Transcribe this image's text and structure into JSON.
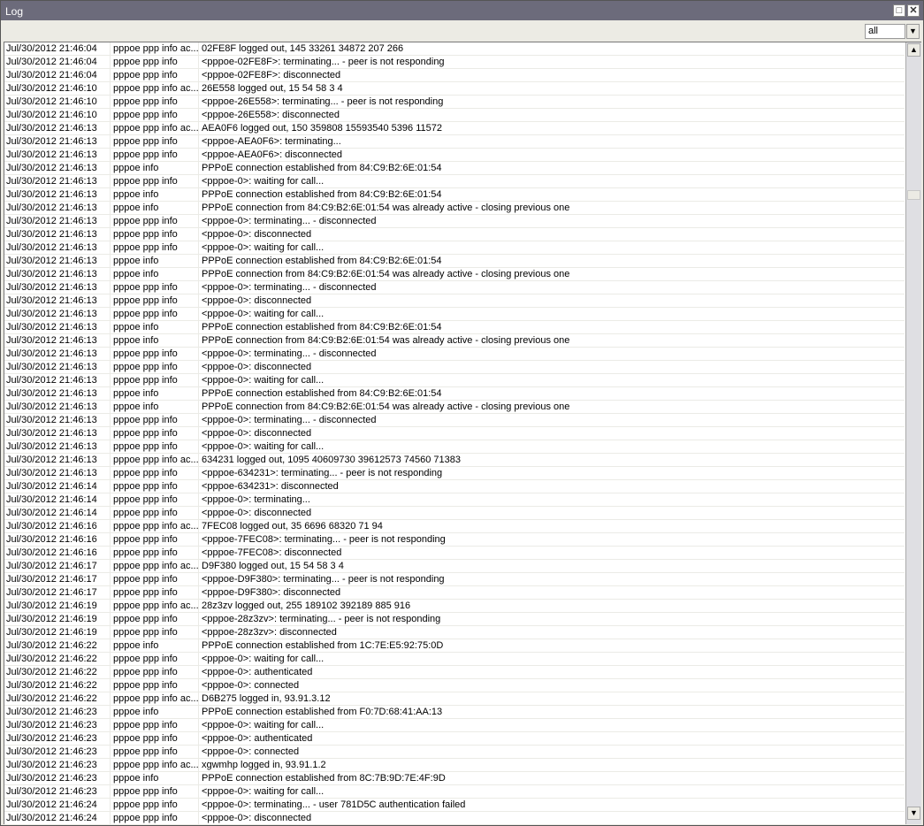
{
  "window": {
    "title": "Log",
    "maximize_icon": "maximize-icon",
    "close_icon": "close-icon"
  },
  "toolbar": {
    "filter_value": "all",
    "scroll_to_end_icon": "scroll-to-end-icon"
  },
  "scrollbar": {
    "position_fraction": 0.18
  },
  "rows": [
    [
      "Jul/30/2012 21:46:04",
      "pppoe ppp info ac...",
      "02FE8F logged out, 145 33261 34872 207 266"
    ],
    [
      "Jul/30/2012 21:46:04",
      "pppoe ppp info",
      "<pppoe-02FE8F>: terminating... - peer is not responding"
    ],
    [
      "Jul/30/2012 21:46:04",
      "pppoe ppp info",
      "<pppoe-02FE8F>: disconnected"
    ],
    [
      "Jul/30/2012 21:46:10",
      "pppoe ppp info ac...",
      "26E558 logged out, 15 54 58 3 4"
    ],
    [
      "Jul/30/2012 21:46:10",
      "pppoe ppp info",
      "<pppoe-26E558>: terminating... - peer is not responding"
    ],
    [
      "Jul/30/2012 21:46:10",
      "pppoe ppp info",
      "<pppoe-26E558>: disconnected"
    ],
    [
      "Jul/30/2012 21:46:13",
      "pppoe ppp info ac...",
      "AEA0F6 logged out, 150 359808 15593540 5396 11572"
    ],
    [
      "Jul/30/2012 21:46:13",
      "pppoe ppp info",
      "<pppoe-AEA0F6>: terminating..."
    ],
    [
      "Jul/30/2012 21:46:13",
      "pppoe ppp info",
      "<pppoe-AEA0F6>: disconnected"
    ],
    [
      "Jul/30/2012 21:46:13",
      "pppoe info",
      "PPPoE connection established from 84:C9:B2:6E:01:54"
    ],
    [
      "Jul/30/2012 21:46:13",
      "pppoe ppp info",
      "<pppoe-0>: waiting for call..."
    ],
    [
      "Jul/30/2012 21:46:13",
      "pppoe info",
      "PPPoE connection established from 84:C9:B2:6E:01:54"
    ],
    [
      "Jul/30/2012 21:46:13",
      "pppoe info",
      "PPPoE connection from 84:C9:B2:6E:01:54 was already active - closing previous one"
    ],
    [
      "Jul/30/2012 21:46:13",
      "pppoe ppp info",
      "<pppoe-0>: terminating... - disconnected"
    ],
    [
      "Jul/30/2012 21:46:13",
      "pppoe ppp info",
      "<pppoe-0>: disconnected"
    ],
    [
      "Jul/30/2012 21:46:13",
      "pppoe ppp info",
      "<pppoe-0>: waiting for call..."
    ],
    [
      "Jul/30/2012 21:46:13",
      "pppoe info",
      "PPPoE connection established from 84:C9:B2:6E:01:54"
    ],
    [
      "Jul/30/2012 21:46:13",
      "pppoe info",
      "PPPoE connection from 84:C9:B2:6E:01:54 was already active - closing previous one"
    ],
    [
      "Jul/30/2012 21:46:13",
      "pppoe ppp info",
      "<pppoe-0>: terminating... - disconnected"
    ],
    [
      "Jul/30/2012 21:46:13",
      "pppoe ppp info",
      "<pppoe-0>: disconnected"
    ],
    [
      "Jul/30/2012 21:46:13",
      "pppoe ppp info",
      "<pppoe-0>: waiting for call..."
    ],
    [
      "Jul/30/2012 21:46:13",
      "pppoe info",
      "PPPoE connection established from 84:C9:B2:6E:01:54"
    ],
    [
      "Jul/30/2012 21:46:13",
      "pppoe info",
      "PPPoE connection from 84:C9:B2:6E:01:54 was already active - closing previous one"
    ],
    [
      "Jul/30/2012 21:46:13",
      "pppoe ppp info",
      "<pppoe-0>: terminating... - disconnected"
    ],
    [
      "Jul/30/2012 21:46:13",
      "pppoe ppp info",
      "<pppoe-0>: disconnected"
    ],
    [
      "Jul/30/2012 21:46:13",
      "pppoe ppp info",
      "<pppoe-0>: waiting for call..."
    ],
    [
      "Jul/30/2012 21:46:13",
      "pppoe info",
      "PPPoE connection established from 84:C9:B2:6E:01:54"
    ],
    [
      "Jul/30/2012 21:46:13",
      "pppoe info",
      "PPPoE connection from 84:C9:B2:6E:01:54 was already active - closing previous one"
    ],
    [
      "Jul/30/2012 21:46:13",
      "pppoe ppp info",
      "<pppoe-0>: terminating... - disconnected"
    ],
    [
      "Jul/30/2012 21:46:13",
      "pppoe ppp info",
      "<pppoe-0>: disconnected"
    ],
    [
      "Jul/30/2012 21:46:13",
      "pppoe ppp info",
      "<pppoe-0>: waiting for call..."
    ],
    [
      "Jul/30/2012 21:46:13",
      "pppoe ppp info ac...",
      "634231 logged out, 1095 40609730 39612573 74560 71383"
    ],
    [
      "Jul/30/2012 21:46:13",
      "pppoe ppp info",
      "<pppoe-634231>: terminating... - peer is not responding"
    ],
    [
      "Jul/30/2012 21:46:14",
      "pppoe ppp info",
      "<pppoe-634231>: disconnected"
    ],
    [
      "Jul/30/2012 21:46:14",
      "pppoe ppp info",
      "<pppoe-0>: terminating..."
    ],
    [
      "Jul/30/2012 21:46:14",
      "pppoe ppp info",
      "<pppoe-0>: disconnected"
    ],
    [
      "Jul/30/2012 21:46:16",
      "pppoe ppp info ac...",
      "7FEC08 logged out, 35 6696 68320 71 94"
    ],
    [
      "Jul/30/2012 21:46:16",
      "pppoe ppp info",
      "<pppoe-7FEC08>: terminating... - peer is not responding"
    ],
    [
      "Jul/30/2012 21:46:16",
      "pppoe ppp info",
      "<pppoe-7FEC08>: disconnected"
    ],
    [
      "Jul/30/2012 21:46:17",
      "pppoe ppp info ac...",
      "D9F380 logged out, 15 54 58 3 4"
    ],
    [
      "Jul/30/2012 21:46:17",
      "pppoe ppp info",
      "<pppoe-D9F380>: terminating... - peer is not responding"
    ],
    [
      "Jul/30/2012 21:46:17",
      "pppoe ppp info",
      "<pppoe-D9F380>: disconnected"
    ],
    [
      "Jul/30/2012 21:46:19",
      "pppoe ppp info ac...",
      "28z3zv logged out, 255 189102 392189 885 916"
    ],
    [
      "Jul/30/2012 21:46:19",
      "pppoe ppp info",
      "<pppoe-28z3zv>: terminating... - peer is not responding"
    ],
    [
      "Jul/30/2012 21:46:19",
      "pppoe ppp info",
      "<pppoe-28z3zv>: disconnected"
    ],
    [
      "Jul/30/2012 21:46:22",
      "pppoe info",
      "PPPoE connection established from 1C:7E:E5:92:75:0D"
    ],
    [
      "Jul/30/2012 21:46:22",
      "pppoe ppp info",
      "<pppoe-0>: waiting for call..."
    ],
    [
      "Jul/30/2012 21:46:22",
      "pppoe ppp info",
      "<pppoe-0>: authenticated"
    ],
    [
      "Jul/30/2012 21:46:22",
      "pppoe ppp info",
      "<pppoe-0>: connected"
    ],
    [
      "Jul/30/2012 21:46:22",
      "pppoe ppp info ac...",
      "D6B275 logged in, 93.91.3.12"
    ],
    [
      "Jul/30/2012 21:46:23",
      "pppoe info",
      "PPPoE connection established from F0:7D:68:41:AA:13"
    ],
    [
      "Jul/30/2012 21:46:23",
      "pppoe ppp info",
      "<pppoe-0>: waiting for call..."
    ],
    [
      "Jul/30/2012 21:46:23",
      "pppoe ppp info",
      "<pppoe-0>: authenticated"
    ],
    [
      "Jul/30/2012 21:46:23",
      "pppoe ppp info",
      "<pppoe-0>: connected"
    ],
    [
      "Jul/30/2012 21:46:23",
      "pppoe ppp info ac...",
      "xgwmhp logged in, 93.91.1.2"
    ],
    [
      "Jul/30/2012 21:46:23",
      "pppoe info",
      "PPPoE connection established from 8C:7B:9D:7E:4F:9D"
    ],
    [
      "Jul/30/2012 21:46:23",
      "pppoe ppp info",
      "<pppoe-0>: waiting for call..."
    ],
    [
      "Jul/30/2012 21:46:24",
      "pppoe ppp info",
      "<pppoe-0>: terminating... - user 781D5C authentication failed"
    ],
    [
      "Jul/30/2012 21:46:24",
      "pppoe ppp info",
      "<pppoe-0>: disconnected"
    ]
  ]
}
